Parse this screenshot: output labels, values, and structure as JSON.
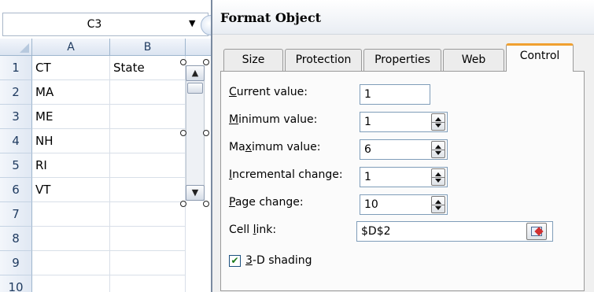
{
  "excel": {
    "namebox": {
      "value": "C3"
    },
    "columns": [
      "A",
      "B"
    ],
    "rows": [
      {
        "num": "1",
        "a": "CT",
        "b": "State"
      },
      {
        "num": "2",
        "a": "MA",
        "b": ""
      },
      {
        "num": "3",
        "a": "ME",
        "b": ""
      },
      {
        "num": "4",
        "a": "NH",
        "b": ""
      },
      {
        "num": "5",
        "a": "RI",
        "b": ""
      },
      {
        "num": "6",
        "a": "VT",
        "b": ""
      },
      {
        "num": "7",
        "a": "",
        "b": ""
      },
      {
        "num": "8",
        "a": "",
        "b": ""
      },
      {
        "num": "9",
        "a": "",
        "b": ""
      },
      {
        "num": "10",
        "a": "",
        "b": ""
      }
    ]
  },
  "dialog": {
    "title": "Format Object",
    "tabs": [
      "Size",
      "Protection",
      "Properties",
      "Web",
      "Control"
    ],
    "active_tab": "Control",
    "fields": {
      "current_value": {
        "pre": "",
        "mn": "C",
        "post": "urrent value:",
        "value": "1"
      },
      "minimum_value": {
        "pre": "",
        "mn": "M",
        "post": "inimum value:",
        "value": "1"
      },
      "maximum_value": {
        "pre": "Ma",
        "mn": "x",
        "post": "imum value:",
        "value": "6"
      },
      "incremental_change": {
        "pre": "",
        "mn": "I",
        "post": "ncremental change:",
        "value": "1"
      },
      "page_change": {
        "pre": "",
        "mn": "P",
        "post": "age change:",
        "value": "10"
      },
      "cell_link": {
        "pre": "Cell ",
        "mn": "l",
        "post": "ink:",
        "value": "$D$2"
      }
    },
    "shading": {
      "mn": "3",
      "post": "-D shading",
      "checked": true,
      "check_glyph": "✔"
    }
  }
}
